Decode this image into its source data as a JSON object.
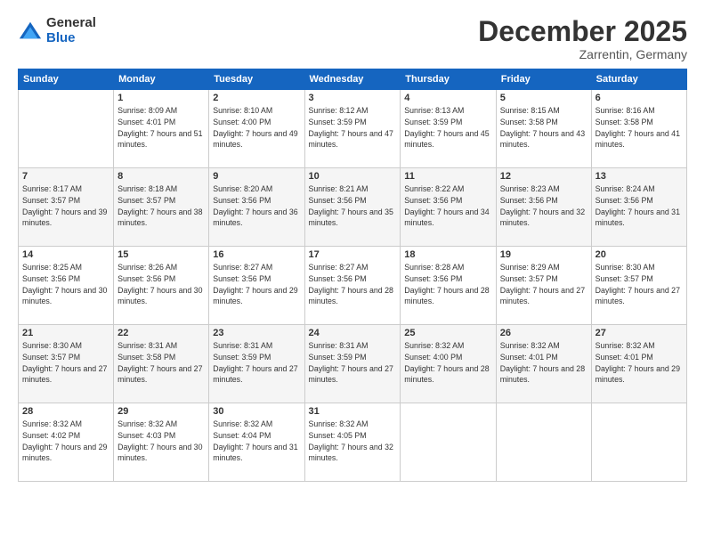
{
  "logo": {
    "general": "General",
    "blue": "Blue"
  },
  "header": {
    "month": "December 2025",
    "location": "Zarrentin, Germany"
  },
  "weekdays": [
    "Sunday",
    "Monday",
    "Tuesday",
    "Wednesday",
    "Thursday",
    "Friday",
    "Saturday"
  ],
  "weeks": [
    [
      {
        "day": "",
        "sunrise": "",
        "sunset": "",
        "daylight": ""
      },
      {
        "day": "1",
        "sunrise": "Sunrise: 8:09 AM",
        "sunset": "Sunset: 4:01 PM",
        "daylight": "Daylight: 7 hours and 51 minutes."
      },
      {
        "day": "2",
        "sunrise": "Sunrise: 8:10 AM",
        "sunset": "Sunset: 4:00 PM",
        "daylight": "Daylight: 7 hours and 49 minutes."
      },
      {
        "day": "3",
        "sunrise": "Sunrise: 8:12 AM",
        "sunset": "Sunset: 3:59 PM",
        "daylight": "Daylight: 7 hours and 47 minutes."
      },
      {
        "day": "4",
        "sunrise": "Sunrise: 8:13 AM",
        "sunset": "Sunset: 3:59 PM",
        "daylight": "Daylight: 7 hours and 45 minutes."
      },
      {
        "day": "5",
        "sunrise": "Sunrise: 8:15 AM",
        "sunset": "Sunset: 3:58 PM",
        "daylight": "Daylight: 7 hours and 43 minutes."
      },
      {
        "day": "6",
        "sunrise": "Sunrise: 8:16 AM",
        "sunset": "Sunset: 3:58 PM",
        "daylight": "Daylight: 7 hours and 41 minutes."
      }
    ],
    [
      {
        "day": "7",
        "sunrise": "Sunrise: 8:17 AM",
        "sunset": "Sunset: 3:57 PM",
        "daylight": "Daylight: 7 hours and 39 minutes."
      },
      {
        "day": "8",
        "sunrise": "Sunrise: 8:18 AM",
        "sunset": "Sunset: 3:57 PM",
        "daylight": "Daylight: 7 hours and 38 minutes."
      },
      {
        "day": "9",
        "sunrise": "Sunrise: 8:20 AM",
        "sunset": "Sunset: 3:56 PM",
        "daylight": "Daylight: 7 hours and 36 minutes."
      },
      {
        "day": "10",
        "sunrise": "Sunrise: 8:21 AM",
        "sunset": "Sunset: 3:56 PM",
        "daylight": "Daylight: 7 hours and 35 minutes."
      },
      {
        "day": "11",
        "sunrise": "Sunrise: 8:22 AM",
        "sunset": "Sunset: 3:56 PM",
        "daylight": "Daylight: 7 hours and 34 minutes."
      },
      {
        "day": "12",
        "sunrise": "Sunrise: 8:23 AM",
        "sunset": "Sunset: 3:56 PM",
        "daylight": "Daylight: 7 hours and 32 minutes."
      },
      {
        "day": "13",
        "sunrise": "Sunrise: 8:24 AM",
        "sunset": "Sunset: 3:56 PM",
        "daylight": "Daylight: 7 hours and 31 minutes."
      }
    ],
    [
      {
        "day": "14",
        "sunrise": "Sunrise: 8:25 AM",
        "sunset": "Sunset: 3:56 PM",
        "daylight": "Daylight: 7 hours and 30 minutes."
      },
      {
        "day": "15",
        "sunrise": "Sunrise: 8:26 AM",
        "sunset": "Sunset: 3:56 PM",
        "daylight": "Daylight: 7 hours and 30 minutes."
      },
      {
        "day": "16",
        "sunrise": "Sunrise: 8:27 AM",
        "sunset": "Sunset: 3:56 PM",
        "daylight": "Daylight: 7 hours and 29 minutes."
      },
      {
        "day": "17",
        "sunrise": "Sunrise: 8:27 AM",
        "sunset": "Sunset: 3:56 PM",
        "daylight": "Daylight: 7 hours and 28 minutes."
      },
      {
        "day": "18",
        "sunrise": "Sunrise: 8:28 AM",
        "sunset": "Sunset: 3:56 PM",
        "daylight": "Daylight: 7 hours and 28 minutes."
      },
      {
        "day": "19",
        "sunrise": "Sunrise: 8:29 AM",
        "sunset": "Sunset: 3:57 PM",
        "daylight": "Daylight: 7 hours and 27 minutes."
      },
      {
        "day": "20",
        "sunrise": "Sunrise: 8:30 AM",
        "sunset": "Sunset: 3:57 PM",
        "daylight": "Daylight: 7 hours and 27 minutes."
      }
    ],
    [
      {
        "day": "21",
        "sunrise": "Sunrise: 8:30 AM",
        "sunset": "Sunset: 3:57 PM",
        "daylight": "Daylight: 7 hours and 27 minutes."
      },
      {
        "day": "22",
        "sunrise": "Sunrise: 8:31 AM",
        "sunset": "Sunset: 3:58 PM",
        "daylight": "Daylight: 7 hours and 27 minutes."
      },
      {
        "day": "23",
        "sunrise": "Sunrise: 8:31 AM",
        "sunset": "Sunset: 3:59 PM",
        "daylight": "Daylight: 7 hours and 27 minutes."
      },
      {
        "day": "24",
        "sunrise": "Sunrise: 8:31 AM",
        "sunset": "Sunset: 3:59 PM",
        "daylight": "Daylight: 7 hours and 27 minutes."
      },
      {
        "day": "25",
        "sunrise": "Sunrise: 8:32 AM",
        "sunset": "Sunset: 4:00 PM",
        "daylight": "Daylight: 7 hours and 28 minutes."
      },
      {
        "day": "26",
        "sunrise": "Sunrise: 8:32 AM",
        "sunset": "Sunset: 4:01 PM",
        "daylight": "Daylight: 7 hours and 28 minutes."
      },
      {
        "day": "27",
        "sunrise": "Sunrise: 8:32 AM",
        "sunset": "Sunset: 4:01 PM",
        "daylight": "Daylight: 7 hours and 29 minutes."
      }
    ],
    [
      {
        "day": "28",
        "sunrise": "Sunrise: 8:32 AM",
        "sunset": "Sunset: 4:02 PM",
        "daylight": "Daylight: 7 hours and 29 minutes."
      },
      {
        "day": "29",
        "sunrise": "Sunrise: 8:32 AM",
        "sunset": "Sunset: 4:03 PM",
        "daylight": "Daylight: 7 hours and 30 minutes."
      },
      {
        "day": "30",
        "sunrise": "Sunrise: 8:32 AM",
        "sunset": "Sunset: 4:04 PM",
        "daylight": "Daylight: 7 hours and 31 minutes."
      },
      {
        "day": "31",
        "sunrise": "Sunrise: 8:32 AM",
        "sunset": "Sunset: 4:05 PM",
        "daylight": "Daylight: 7 hours and 32 minutes."
      },
      {
        "day": "",
        "sunrise": "",
        "sunset": "",
        "daylight": ""
      },
      {
        "day": "",
        "sunrise": "",
        "sunset": "",
        "daylight": ""
      },
      {
        "day": "",
        "sunrise": "",
        "sunset": "",
        "daylight": ""
      }
    ]
  ]
}
